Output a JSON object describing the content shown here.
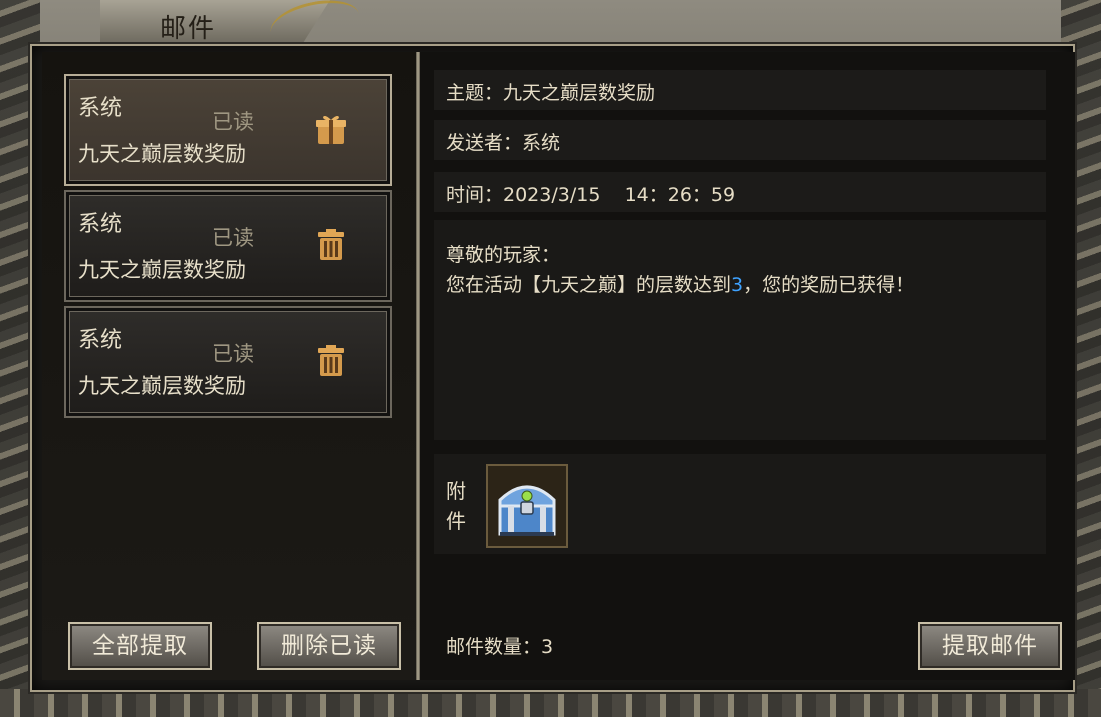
{
  "window": {
    "title": "邮件"
  },
  "mail_list": [
    {
      "sender": "系统",
      "status": "已读",
      "subject": "九天之巅层数奖励",
      "icon": "gift-icon",
      "selected": true
    },
    {
      "sender": "系统",
      "status": "已读",
      "subject": "九天之巅层数奖励",
      "icon": "trash-icon",
      "selected": false
    },
    {
      "sender": "系统",
      "status": "已读",
      "subject": "九天之巅层数奖励",
      "icon": "trash-icon",
      "selected": false
    }
  ],
  "buttons": {
    "claim_all": "全部提取",
    "delete_read": "删除已读",
    "claim_mail": "提取邮件"
  },
  "detail": {
    "subject": "主题：九天之巅层数奖励",
    "sender": "发送者：系统",
    "time": "时间：2023/3/15    14：26：59",
    "greeting": "尊敬的玩家：",
    "body_prefix": "您在活动【九天之巅】的层数达到",
    "body_value": "3",
    "body_suffix": "，您的奖励已获得！",
    "attachment_label": "附件",
    "attachment_item": "treasure-chest-icon"
  },
  "footer": {
    "mail_count": "邮件数量：3"
  },
  "colors": {
    "highlight": "#3ea2ff",
    "text": "#e6ddc6",
    "gold": "#d49a4c"
  }
}
